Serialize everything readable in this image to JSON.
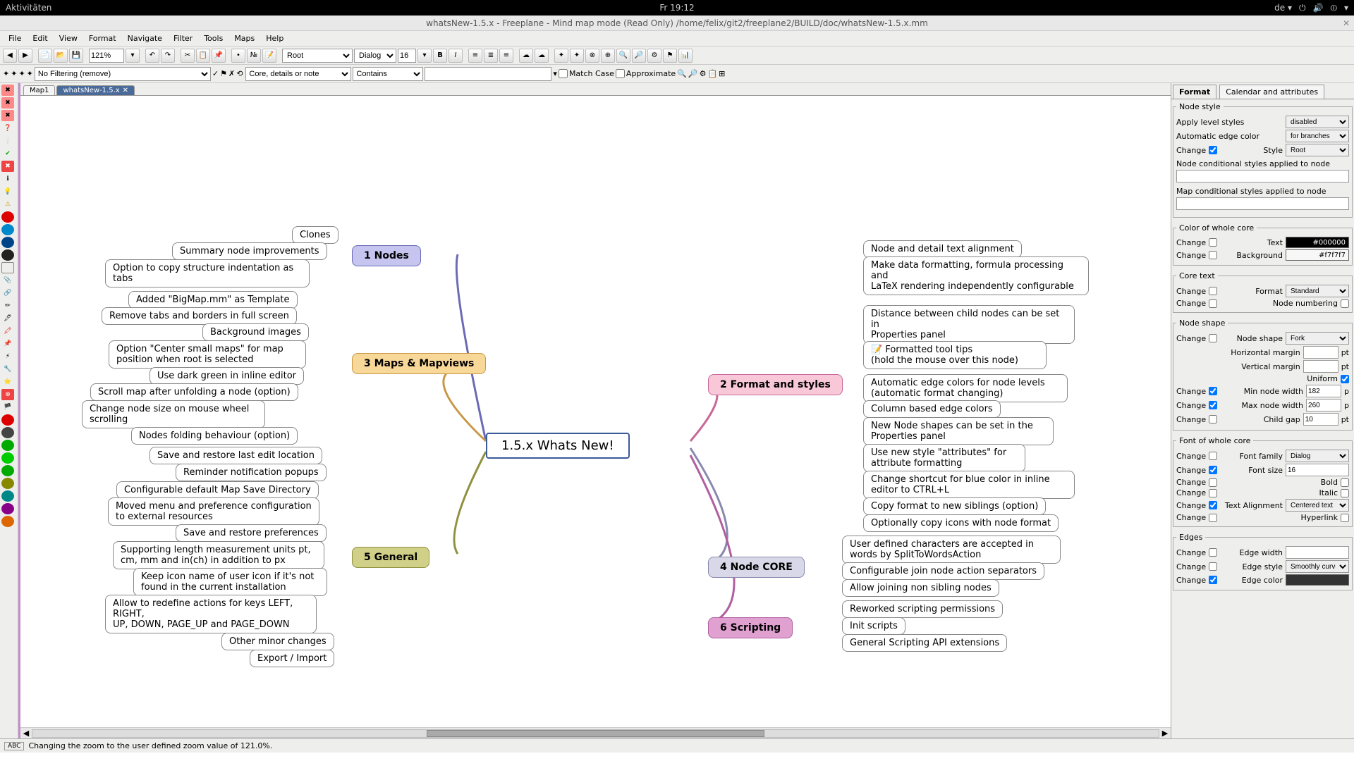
{
  "topbar": {
    "activities": "Aktivitäten",
    "clock": "Fr 19:12",
    "lang": "de ▾"
  },
  "titlebar": {
    "text": "whatsNew-1.5.x - Freeplane - Mind map mode (Read Only) /home/felix/git2/freeplane2/BUILD/doc/whatsNew-1.5.x.mm"
  },
  "menu": {
    "items": [
      "File",
      "Edit",
      "View",
      "Format",
      "Navigate",
      "Filter",
      "Tools",
      "Maps",
      "Help"
    ]
  },
  "toolbar": {
    "zoom": "121%",
    "style": "Root",
    "font": "Dialog",
    "size": "16"
  },
  "filterbar": {
    "filter": "No Filtering (remove)",
    "scope": "Core, details or note",
    "op": "Contains",
    "match": "Match Case",
    "approx": "Approximate"
  },
  "tabs": {
    "t1": "Map1",
    "t2": "whatsNew-1.5.x"
  },
  "mindmap": {
    "root": "1.5.x Whats New!",
    "b1": {
      "title": "1 Nodes",
      "leaves": [
        "Clones",
        "Summary node improvements",
        "Option to copy structure indentation as tabs"
      ]
    },
    "b2": {
      "title": "2 Format and styles",
      "leaves": [
        "Node and detail text alignment",
        "Make data formatting, formula processing and\nLaTeX rendering independently configurable",
        "Distance between child nodes can be set in\nProperties panel",
        "📝 Formatted tool tips\n     (hold the mouse over this node)",
        "Automatic edge colors for node levels (automatic format changing)",
        "Column based edge colors",
        "New Node shapes can be set in the Properties panel",
        "Use new style \"attributes\" for attribute formatting",
        "Change shortcut for blue color in inline editor to CTRL+L",
        "Copy format to new siblings (option)",
        "Optionally copy icons with node format"
      ]
    },
    "b3": {
      "title": "3 Maps & Mapviews",
      "leaves": [
        "Added \"BigMap.mm\" as Template",
        "Remove tabs and borders in full screen",
        "Background images",
        "Option \"Center small maps\" for map position when root is selected",
        "Use dark green in inline editor",
        "Scroll map after unfolding a node (option)",
        "Change node size on mouse wheel scrolling",
        "Nodes folding behaviour (option)"
      ]
    },
    "b4": {
      "title": "4 Node CORE",
      "leaves": [
        "User defined characters are accepted in words by SplitToWordsAction",
        "Configurable join node action separators",
        "Allow joining non sibling nodes"
      ]
    },
    "b5": {
      "title": "5 General",
      "leaves": [
        "Save and restore last edit location",
        "Reminder notification popups",
        "Configurable default Map Save Directory",
        "Moved menu and preference configuration to external resources",
        "Save and restore preferences",
        "Supporting length measurement units pt, cm, mm and in(ch) in addition to px",
        "Keep icon name of user icon if it's not found in the current installation",
        "Allow to redefine actions for keys LEFT, RIGHT,\nUP, DOWN, PAGE_UP and PAGE_DOWN",
        "Other minor changes",
        "Export / Import"
      ]
    },
    "b6": {
      "title": "6 Scripting",
      "leaves": [
        "Reworked scripting permissions",
        "Init scripts",
        "General Scripting API extensions"
      ]
    }
  },
  "panel": {
    "tabs": {
      "format": "Format",
      "cal": "Calendar and attributes"
    },
    "nodestyle": {
      "legend": "Node style",
      "apply_label": "Apply level styles",
      "apply_val": "disabled",
      "aec_label": "Automatic edge color",
      "aec_val": "for branches",
      "change": "Change",
      "style_label": "Style",
      "style_val": "Root",
      "cond1": "Node conditional styles applied to node",
      "cond2": "Map conditional styles applied to node"
    },
    "colorcore": {
      "legend": "Color of whole core",
      "text_label": "Text",
      "text_val": "#000000",
      "bg_label": "Background",
      "bg_val": "#f7f7f7"
    },
    "coretext": {
      "legend": "Core text",
      "format_label": "Format",
      "format_val": "Standard",
      "num_label": "Node numbering"
    },
    "nodeshape": {
      "legend": "Node shape",
      "shape_label": "Node shape",
      "shape_val": "Fork",
      "hm": "Horizontal margin",
      "vm": "Vertical margin",
      "pt": "pt",
      "uniform": "Uniform",
      "minw_label": "Min node width",
      "minw_val": "182",
      "maxw_label": "Max node width",
      "maxw_val": "260",
      "gap_label": "Child gap",
      "gap_val": "10"
    },
    "font": {
      "legend": "Font of whole core",
      "family_label": "Font family",
      "family_val": "Dialog",
      "size_label": "Font size",
      "size_val": "16",
      "bold": "Bold",
      "italic": "Italic",
      "align_label": "Text Alignment",
      "align_val": "Centered text",
      "hyper": "Hyperlink"
    },
    "edges": {
      "legend": "Edges",
      "w_label": "Edge width",
      "s_label": "Edge style",
      "s_val": "Smoothly curved (",
      "c_label": "Edge color"
    }
  },
  "status": {
    "text": "Changing the zoom to the user defined zoom value of 121.0%."
  }
}
